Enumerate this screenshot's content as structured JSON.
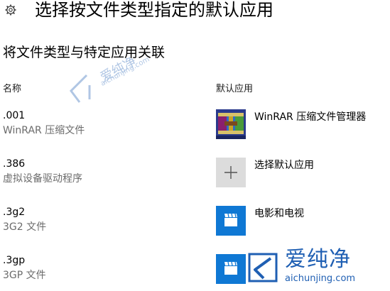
{
  "header": {
    "title": "选择按文件类型指定的默认应用",
    "icon": "gear-icon"
  },
  "section": {
    "title": "将文件类型与特定应用关联"
  },
  "columns": {
    "name": "名称",
    "default_app": "默认应用"
  },
  "rows": [
    {
      "ext": ".001",
      "desc": "WinRAR 压缩文件",
      "app": "WinRAR 压缩文件管理器",
      "app_icon": "winrar-icon"
    },
    {
      "ext": ".386",
      "desc": "虚拟设备驱动程序",
      "app": "选择默认应用",
      "app_icon": "plus-icon"
    },
    {
      "ext": ".3g2",
      "desc": "3G2 文件",
      "app": "电影和电视",
      "app_icon": "movies-tv-icon"
    },
    {
      "ext": ".3gp",
      "desc": "3GP 文件",
      "app": "",
      "app_icon": "movies-tv-icon"
    }
  ],
  "watermark": {
    "cn": "爱纯净",
    "en": "aichunjing.com"
  },
  "colors": {
    "accent": "#0f78d4",
    "watermark": "#1f5fb3"
  }
}
